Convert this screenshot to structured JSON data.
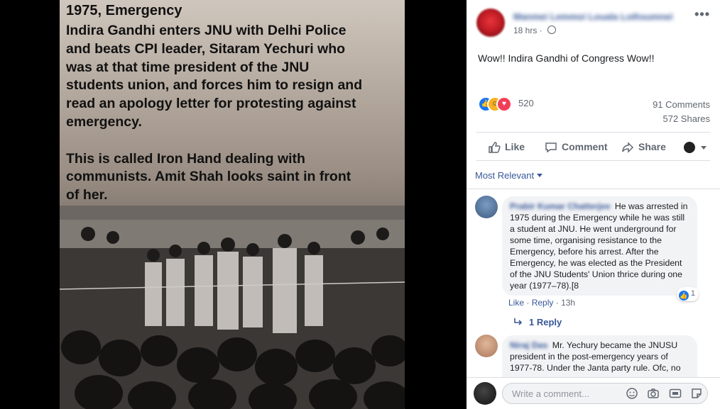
{
  "photo": {
    "title": "1975, Emergency",
    "body": "Indira Gandhi enters JNU with Delhi Police\nand beats CPI leader, Sitaram Yechuri who\nwas at that time president of the JNU\nstudents union, and forces him to resign and\nread an apology letter for protesting against\nemergency.\n\nThis is called Iron Hand dealing with\ncommunists. Amit Shah looks saint in front\nof her."
  },
  "post": {
    "author": "Manmei Lemmoi Louala Lothsumnei",
    "time": "18 hrs",
    "text": "Wow!! Indira Gandhi of Congress Wow!!",
    "reaction_count": "520",
    "comments_count": "91 Comments",
    "shares_count": "572 Shares"
  },
  "actions": {
    "like": "Like",
    "comment": "Comment",
    "share": "Share"
  },
  "sort": {
    "label": "Most Relevant"
  },
  "comments": [
    {
      "name": "Prabir Kumar Chatterjee",
      "text": "He was arrested in 1975 during the Emergency while he was still a student at JNU. He went underground for some time, organising resistance to the Emergency, before his arrest. After the Emergency, he was elected as the President of the JNU Students' Union thrice during one year (1977–78).[8",
      "reaction_count": "1",
      "like_label": "Like",
      "reply_label": "Reply",
      "time": "13h",
      "replies_label": "1 Reply"
    },
    {
      "name": "Niraj Das",
      "text": "Mr. Yechury became the JNUSU president in the post-emergency years of 1977-78. Under the Janta party rule. Ofc, no"
    }
  ],
  "composer": {
    "placeholder": "Write a comment..."
  },
  "colors": {
    "link": "#385898",
    "like_blue": "#1877f2",
    "muted": "#606770"
  }
}
